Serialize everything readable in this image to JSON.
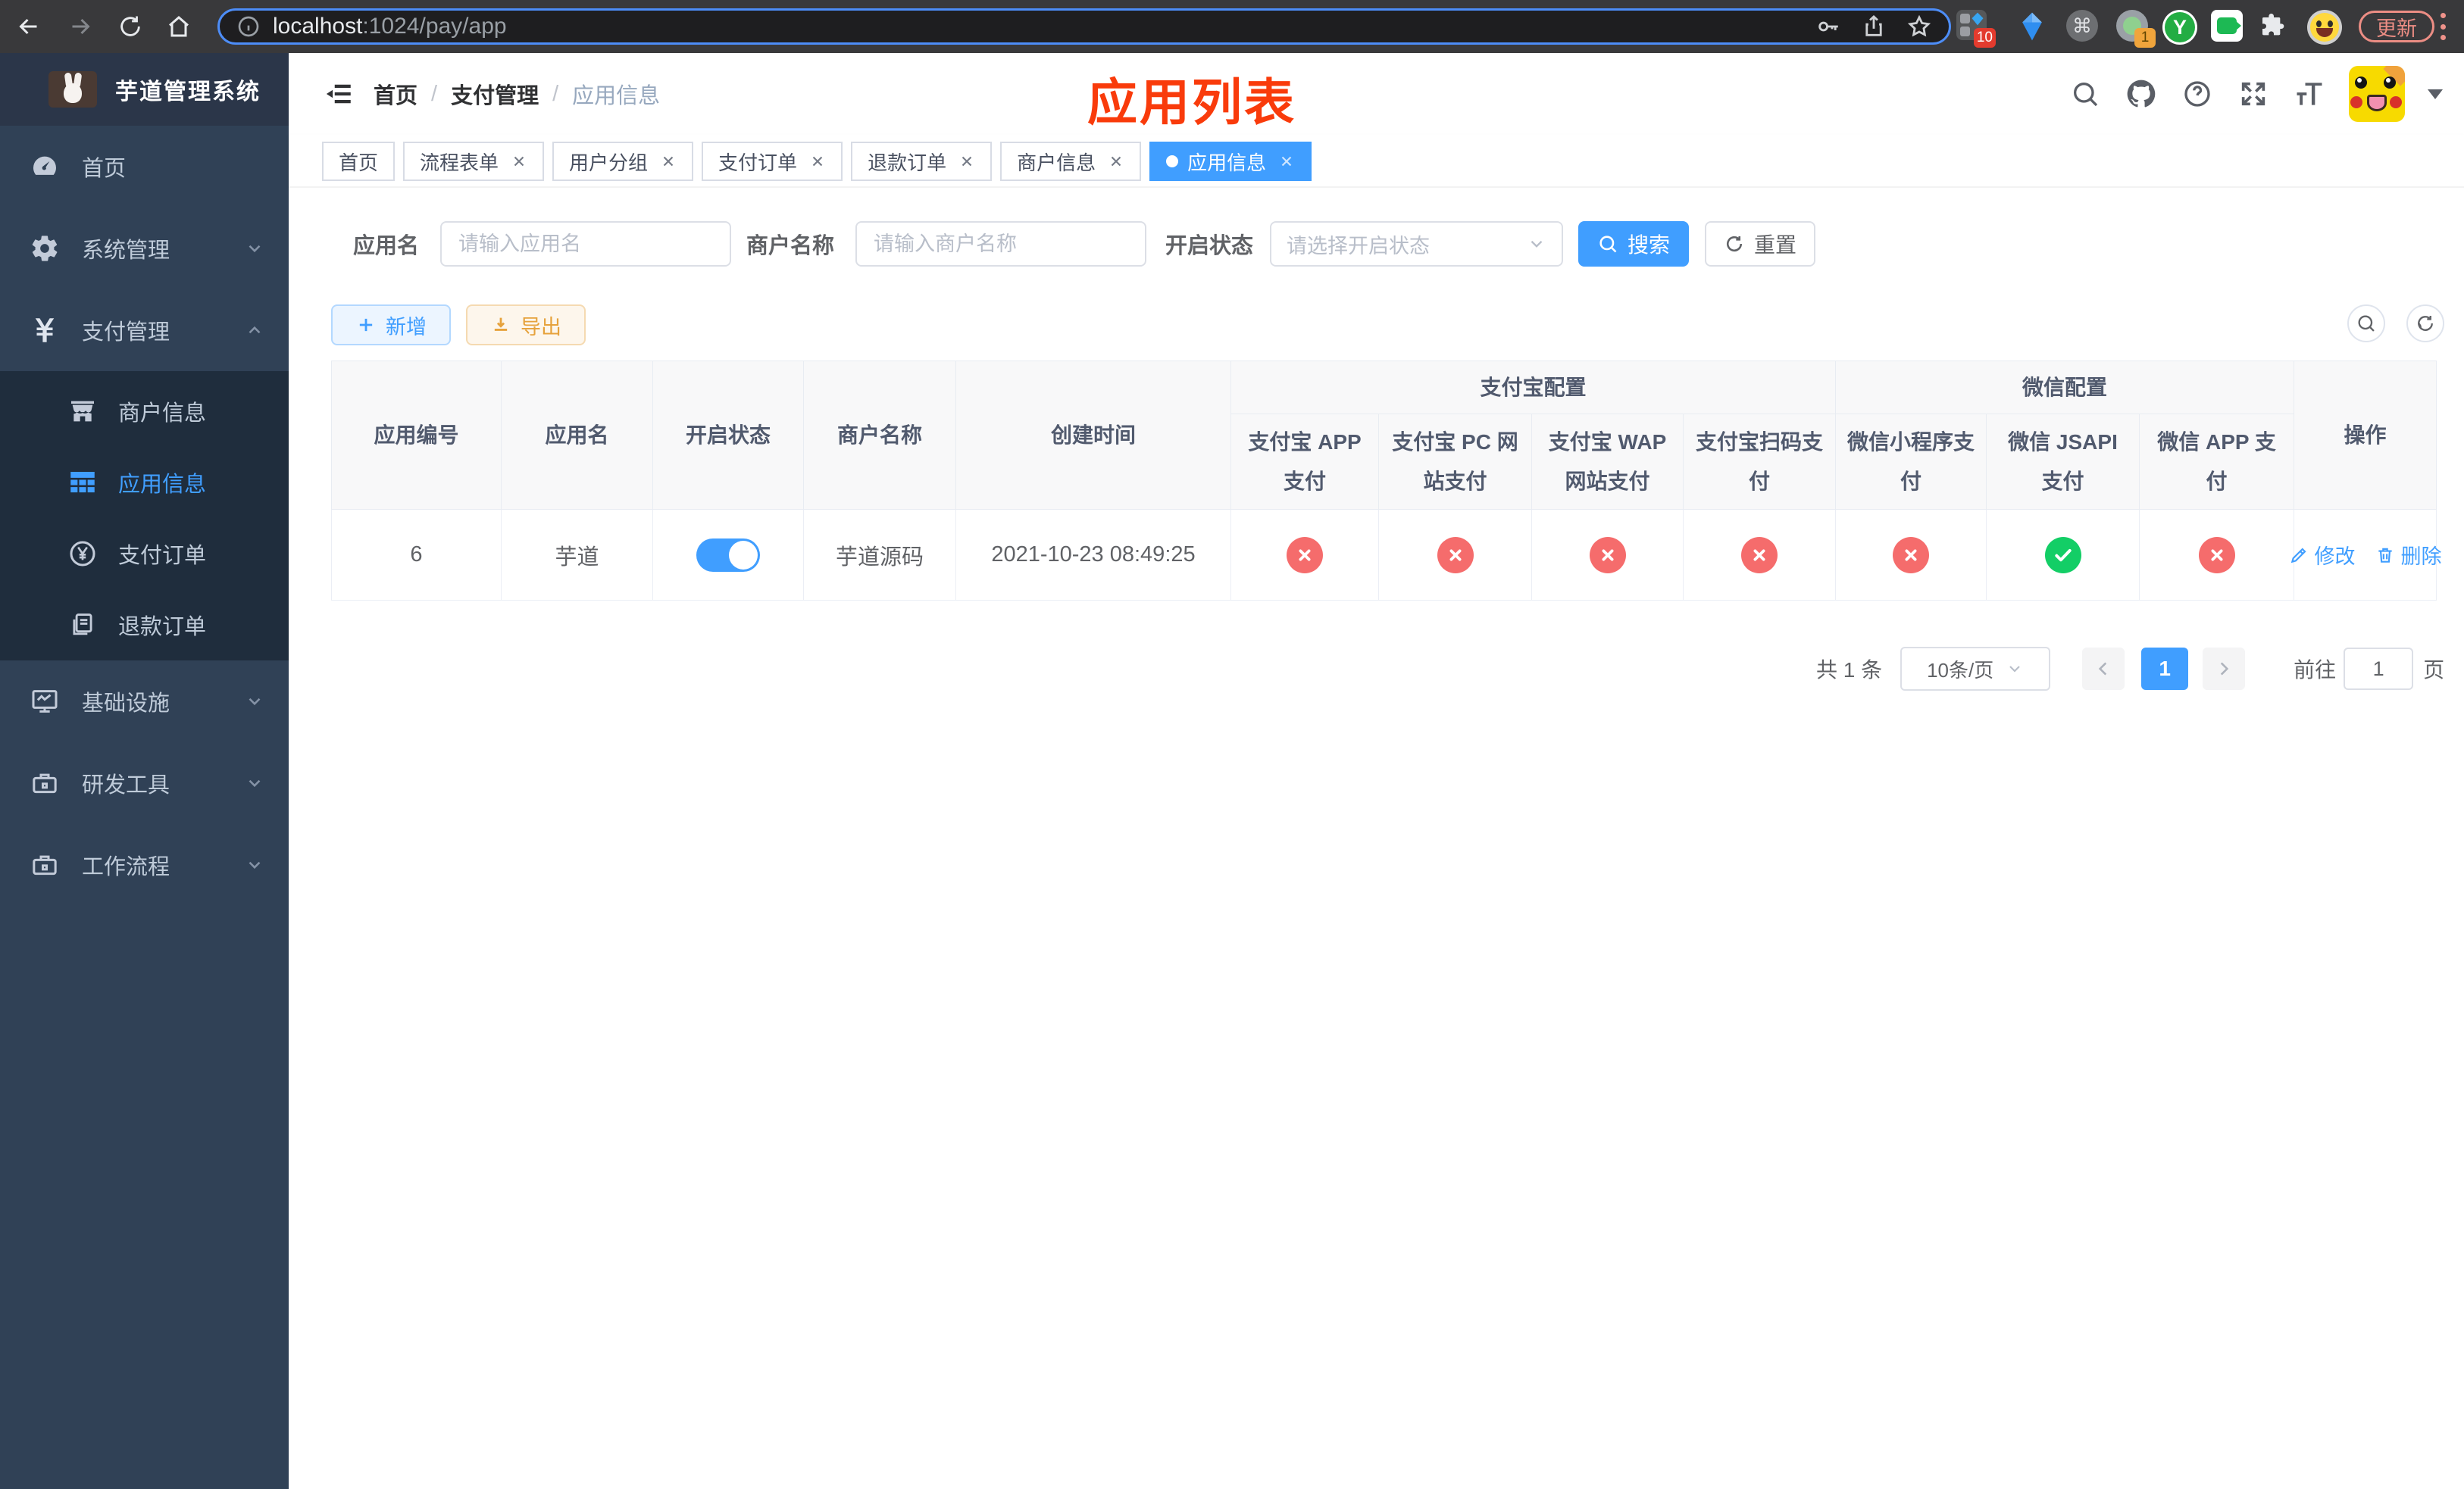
{
  "colors": {
    "primary": "#409eff",
    "annotation_red": "#f93b0b",
    "success_green": "#13ce66",
    "danger_red": "#f56c6c",
    "sidebar_bg": "#304156",
    "submenu_bg": "#1f2d3d",
    "export_orange": "#e6a23c"
  },
  "browser": {
    "url_host": "localhost",
    "url_path": ":1024/pay/app",
    "update_button": "更新",
    "ext_badge_1": "10",
    "ext_badge_2": "1",
    "ext_letter": "Y"
  },
  "sidebar": {
    "logo_title": "芋道管理系统",
    "items": [
      {
        "label": "首页"
      },
      {
        "label": "系统管理"
      },
      {
        "label": "支付管理"
      }
    ],
    "submenu": [
      {
        "label": "商户信息",
        "active": false
      },
      {
        "label": "应用信息",
        "active": true
      },
      {
        "label": "支付订单",
        "active": false
      },
      {
        "label": "退款订单",
        "active": false
      }
    ],
    "items_bottom": [
      {
        "label": "基础设施"
      },
      {
        "label": "研发工具"
      },
      {
        "label": "工作流程"
      }
    ]
  },
  "header": {
    "breadcrumb": [
      "首页",
      "支付管理",
      "应用信息"
    ],
    "separator": "/",
    "page_annotation": "应用列表"
  },
  "tabs": [
    {
      "label": "首页",
      "closable": false,
      "active": false
    },
    {
      "label": "流程表单",
      "closable": true,
      "active": false
    },
    {
      "label": "用户分组",
      "closable": true,
      "active": false
    },
    {
      "label": "支付订单",
      "closable": true,
      "active": false
    },
    {
      "label": "退款订单",
      "closable": true,
      "active": false
    },
    {
      "label": "商户信息",
      "closable": true,
      "active": false
    },
    {
      "label": "应用信息",
      "closable": true,
      "active": true
    }
  ],
  "filters": {
    "app_name_label": "应用名",
    "app_name_placeholder": "请输入应用名",
    "merchant_label": "商户名称",
    "merchant_placeholder": "请输入商户名称",
    "status_label": "开启状态",
    "status_placeholder": "请选择开启状态",
    "search_label": "搜索",
    "reset_label": "重置"
  },
  "toolbar": {
    "add_label": "新增",
    "export_label": "导出"
  },
  "table": {
    "columns": [
      "应用编号",
      "应用名",
      "开启状态",
      "商户名称",
      "创建时间"
    ],
    "group_alipay": "支付宝配置",
    "group_wechat": "微信配置",
    "sub_columns": [
      "支付宝 APP 支付",
      "支付宝 PC 网站支付",
      "支付宝 WAP 网站支付",
      "支付宝扫码支付",
      "微信小程序支付",
      "微信 JSAPI 支付",
      "微信 APP 支付"
    ],
    "actions_col": "操作",
    "row": {
      "id": "6",
      "name": "芋道",
      "enabled": true,
      "merchant": "芋道源码",
      "created": "2021-10-23 08:49:25",
      "configs": [
        false,
        false,
        false,
        false,
        false,
        true,
        false
      ],
      "edit_label": "修改",
      "delete_label": "删除"
    }
  },
  "pagination": {
    "total": "共 1 条",
    "page_size": "10条/页",
    "current": "1",
    "goto_label": "前往",
    "goto_value": "1",
    "page_suffix": "页"
  }
}
